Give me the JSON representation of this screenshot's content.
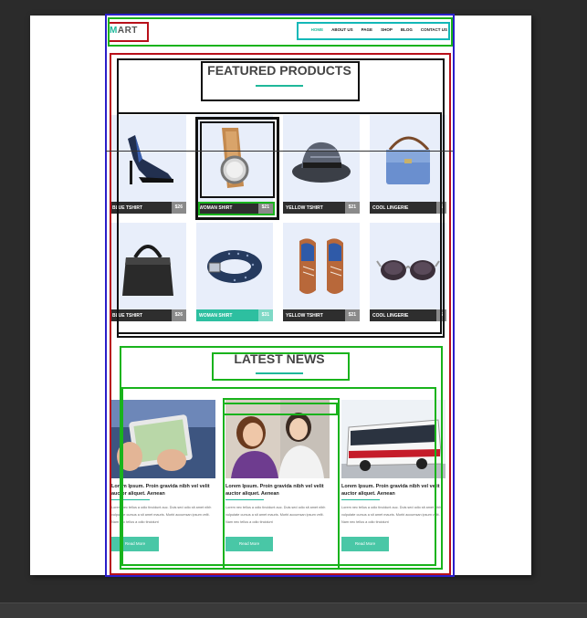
{
  "header": {
    "logo_first": "M",
    "logo_rest": "ART",
    "nav": [
      "HOME",
      "ABOUT US",
      "PAGE",
      "SHOP",
      "BLOG",
      "CONTACT US"
    ]
  },
  "featured": {
    "title": "FEATURED PRODUCTS",
    "products": [
      {
        "name": "BLUE TSHIRT",
        "price": "$26",
        "icon": "high-heel-shoe-icon"
      },
      {
        "name": "WOMAN SHIRT",
        "price": "$21",
        "icon": "watch-icon"
      },
      {
        "name": "YELLOW TSHIRT",
        "price": "$21",
        "icon": "hat-icon"
      },
      {
        "name": "COOL LINGERIE",
        "price": "$",
        "icon": "bag-icon"
      },
      {
        "name": "BLUE TSHIRT",
        "price": "$26",
        "icon": "handbag-icon"
      },
      {
        "name": "WOMAN SHIRT",
        "price": "$31",
        "icon": "belt-icon"
      },
      {
        "name": "YELLOW TSHIRT",
        "price": "$21",
        "icon": "shoes-icon"
      },
      {
        "name": "COOL LINGERIE",
        "price": "$",
        "icon": "sunglasses-icon"
      }
    ]
  },
  "news": {
    "title": "LATEST NEWS",
    "items": [
      {
        "title": "Lorem Ipsum. Proin gravida nibh vel velit auctor aliquet. Aenean",
        "text": "Lorem nec tellus a odio tincidunt auc. Duis sed odio sit amet nibh vulputate cursus a sit amet mauris. Morbi accumsan ipsum velit. Nam nec tellus a odio tincidunt",
        "button": "Read More"
      },
      {
        "title": "Lorem Ipsum. Proin gravida nibh vel velit auctor aliquet. Aenean",
        "text": "Lorem nec tellus a odio tincidunt auc. Duis sed odio sit amet nibh vulputate cursus a sit amet mauris. Morbi accumsan ipsum velit. Nam nec tellus a odio tincidunt",
        "button": "Read More"
      },
      {
        "title": "Lorem Ipsum. Proin gravida nibh vel velit auctor aliquet. Aenean",
        "text": "Lorem nec tellus a odio tincidunt auc. Duis sed odio sit amet nibh vulputate cursus a sit amet mauris. Morbi accumsan ipsum velit. Nam nec tellus a odio tincidunt",
        "button": "Read More"
      }
    ]
  },
  "colors": {
    "accent": "#1fb89a",
    "dark_bar": "#2e2e2e",
    "teal_bar": "#2dbfa0"
  }
}
